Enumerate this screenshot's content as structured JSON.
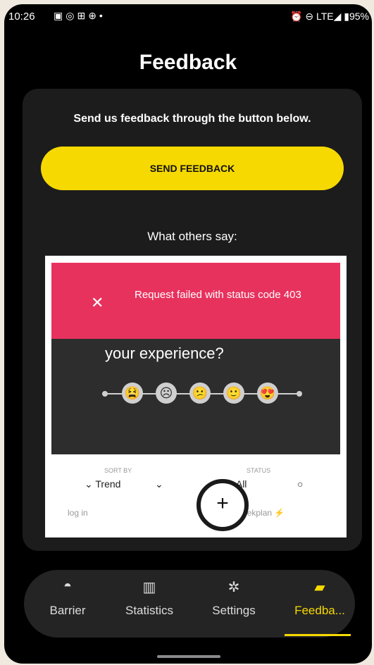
{
  "status_bar": {
    "time": "10:26",
    "left_icons": [
      "message-icon",
      "whatsapp-icon",
      "app-icon",
      "pinterest-icon",
      "dot-icon"
    ],
    "right_text": "⏰ ⊖ LTE◢ ▮95%"
  },
  "header": {
    "title": "Feedback"
  },
  "card": {
    "intro": "Send us feedback through the button below.",
    "send_label": "SEND FEEDBACK",
    "others_label": "What others say:"
  },
  "embed": {
    "error_message": "Request failed with status code 403",
    "question": "your experience?",
    "faces": [
      "😫",
      "☹",
      "😕",
      "🙂",
      "😍"
    ],
    "sort_label": "SORT BY",
    "sort_value": "Trend",
    "status_label": "STATUS",
    "status_value": "All",
    "login": "log in",
    "powered": "run on Sleekplan ⚡"
  },
  "nav": {
    "items": [
      {
        "label": "Barrier",
        "icon": "barrier-icon"
      },
      {
        "label": "Statistics",
        "icon": "statistics-icon"
      },
      {
        "label": "Settings",
        "icon": "gear-icon"
      },
      {
        "label": "Feedba...",
        "icon": "feedback-icon"
      }
    ],
    "active_index": 3
  },
  "colors": {
    "accent": "#f6d900",
    "error": "#e8325e",
    "card_bg": "#1c1c1c"
  }
}
